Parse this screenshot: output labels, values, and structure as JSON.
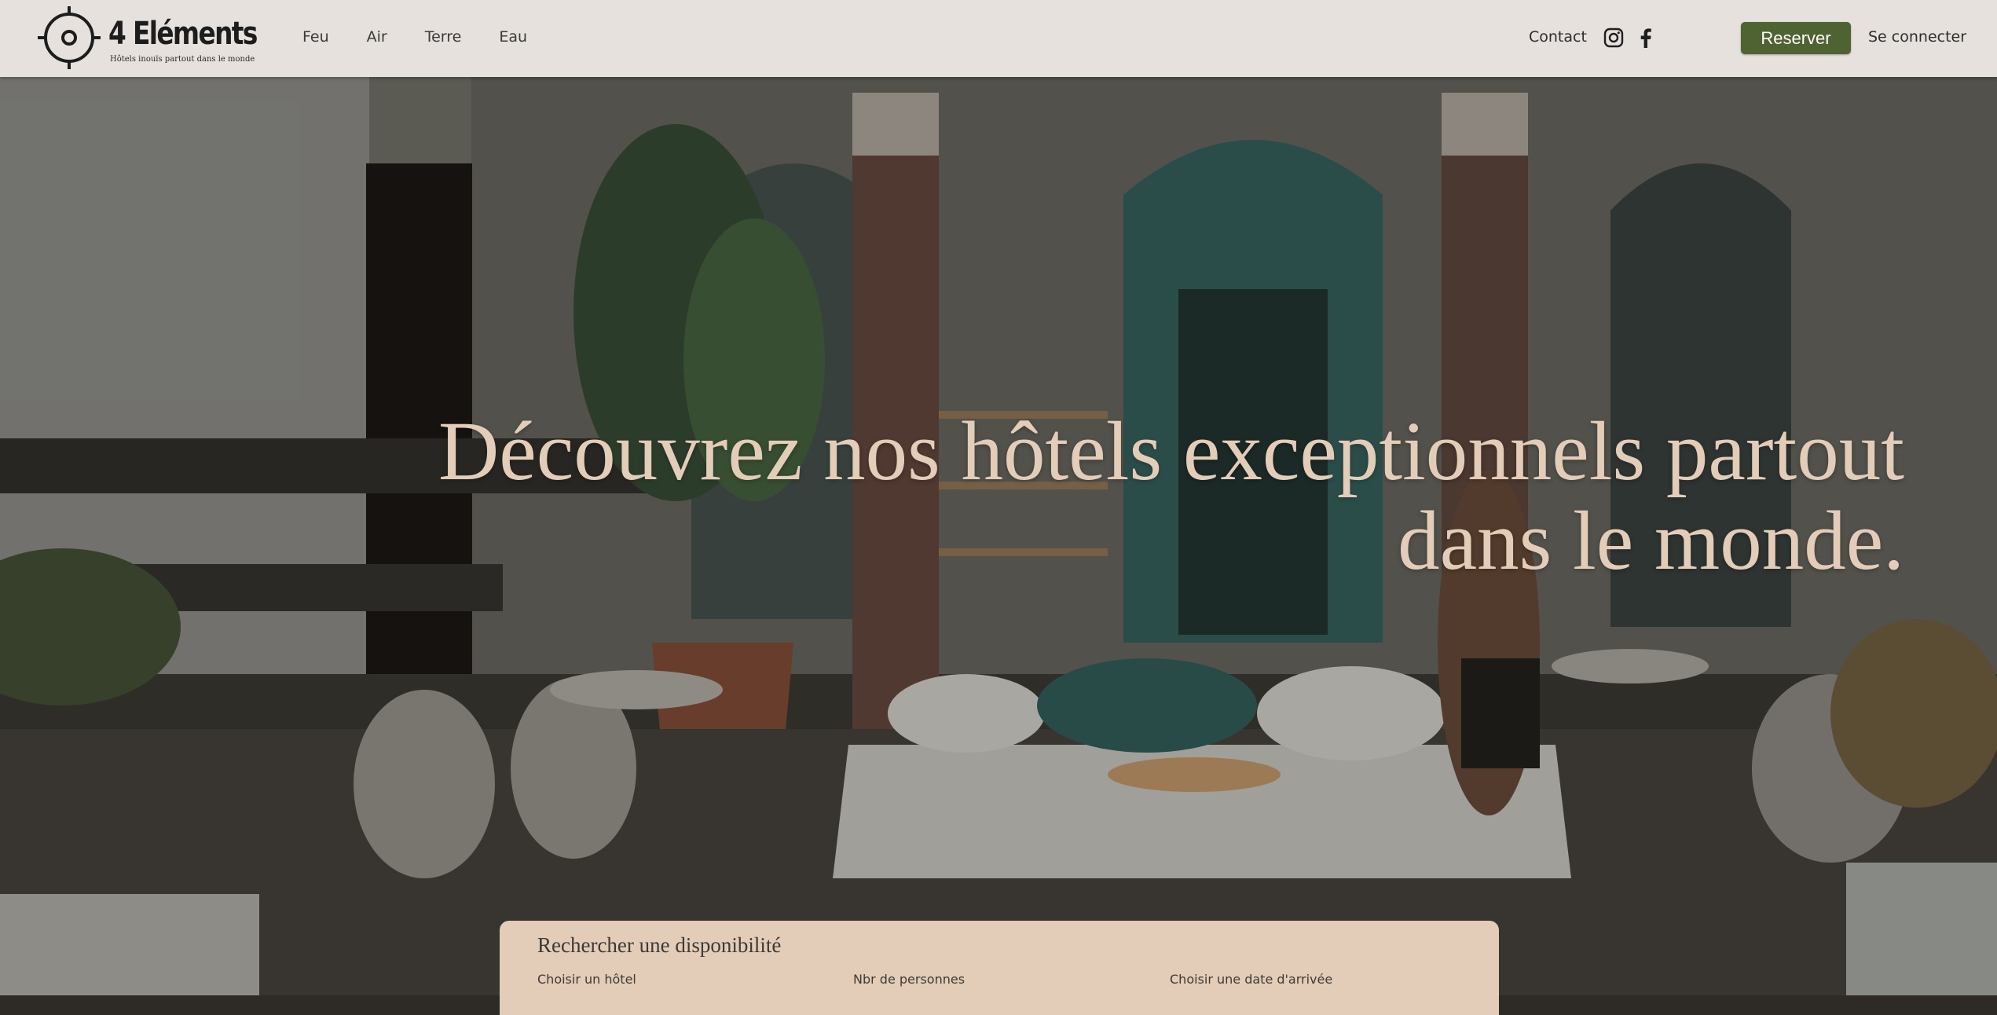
{
  "header": {
    "brand": {
      "name": "4 Eléments",
      "tagline": "Hôtels inouïs partout dans le monde"
    },
    "nav": [
      {
        "label": "Feu"
      },
      {
        "label": "Air"
      },
      {
        "label": "Terre"
      },
      {
        "label": "Eau"
      }
    ],
    "contact_label": "Contact",
    "social_icons": [
      "instagram-icon",
      "facebook-icon"
    ],
    "reserve_label": "Reserver",
    "login_label": "Se connecter"
  },
  "hero": {
    "title_line1": "Découvrez nos hôtels exceptionnels partout",
    "title_line2": "dans le monde."
  },
  "search": {
    "title": "Rechercher une disponibilité",
    "fields": [
      {
        "label": "Choisir un hôtel"
      },
      {
        "label": "Nbr de personnes"
      },
      {
        "label": "Choisir une date d'arrivée"
      }
    ]
  },
  "colors": {
    "header_bg": "#e6e1dc",
    "accent_green": "#4e6331",
    "hero_text": "#e3cdb8",
    "panel_bg": "#e3cdb8"
  }
}
